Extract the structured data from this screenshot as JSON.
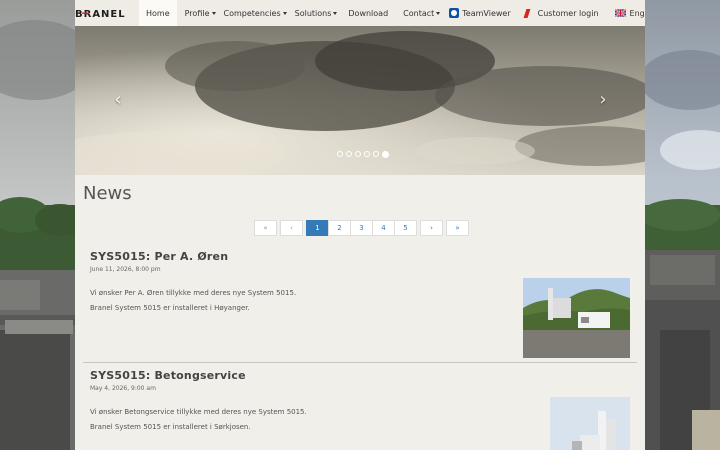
{
  "brand": {
    "name": "BRANEL"
  },
  "nav": {
    "items": [
      {
        "label": "Home",
        "dropdown": false,
        "active": true
      },
      {
        "label": "Profile",
        "dropdown": true
      },
      {
        "label": "Competencies",
        "dropdown": true
      },
      {
        "label": "Solutions",
        "dropdown": true
      },
      {
        "label": "Download",
        "dropdown": false
      },
      {
        "label": "Contact",
        "dropdown": true
      },
      {
        "label": "TeamViewer",
        "dropdown": false,
        "icon": "teamviewer-icon"
      },
      {
        "label": "Customer login",
        "dropdown": false,
        "icon": "red-flag-icon"
      },
      {
        "label": "English",
        "dropdown": true,
        "icon": "uk-flag-icon"
      }
    ]
  },
  "carousel": {
    "prev_icon": "chevron-left-icon",
    "next_icon": "chevron-right-icon",
    "prev_glyph": "‹",
    "next_glyph": "›",
    "slide_count": 6,
    "active_slide": 6
  },
  "news": {
    "title": "News",
    "pagination": {
      "first": "«",
      "prev": "‹",
      "pages": [
        "1",
        "2",
        "3",
        "4",
        "5"
      ],
      "current": "1",
      "next": "›",
      "last": "»"
    },
    "articles": [
      {
        "title": "SYS5015: Per A. Øren",
        "date": "June 11, 2026, 8:00 pm",
        "lines": [
          "Vi ønsker Per A. Øren tillykke med deres nye System 5015.",
          "Branel System 5015 er installeret i Høyanger."
        ]
      },
      {
        "title": "SYS5015: Betongservice",
        "date": "May 4, 2026, 9:00 am",
        "lines": [
          "Vi ønsker Betongservice tillykke med deres nye System 5015.",
          "Branel System 5015 er installeret i Sørkjosen."
        ]
      }
    ]
  },
  "colors": {
    "accent": "#337ab7",
    "page_bg": "#f1efe9",
    "navbar_bg": "#efece6",
    "teamviewer": "#0e4fa3",
    "login_flag": "#d8231f"
  }
}
